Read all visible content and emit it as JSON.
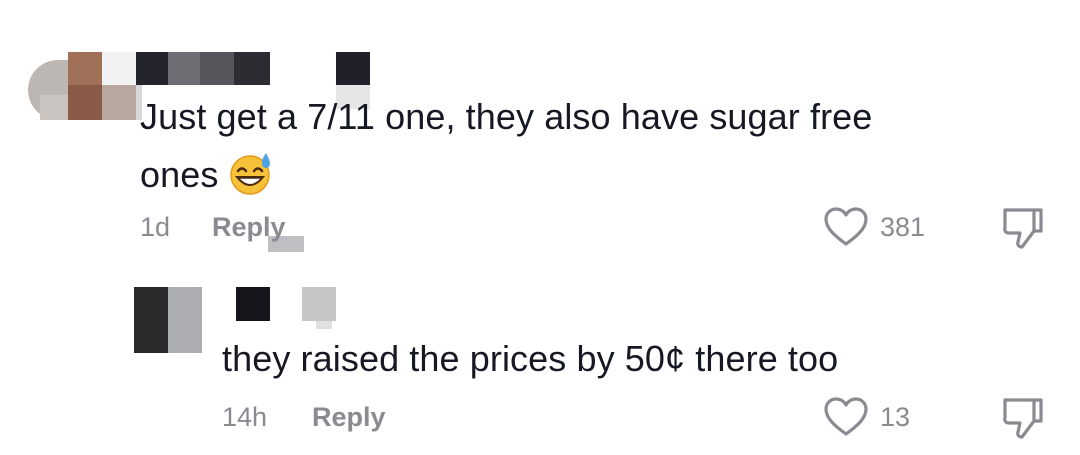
{
  "comments": [
    {
      "text_line1": "Just get a 7/11 one, they also have sugar free",
      "text_line2": "ones",
      "emoji": "grinning-sweat-emoji",
      "time": "1d",
      "reply_label": "Reply",
      "likes": "381"
    },
    {
      "text": "they raised the prices by 50¢ there too",
      "time": "14h",
      "reply_label": "Reply",
      "likes": "13"
    }
  ],
  "icons": {
    "like": "heart-outline-icon",
    "dislike": "thumbs-down-icon"
  },
  "colors": {
    "text": "#161823",
    "meta": "#8a8b91"
  }
}
